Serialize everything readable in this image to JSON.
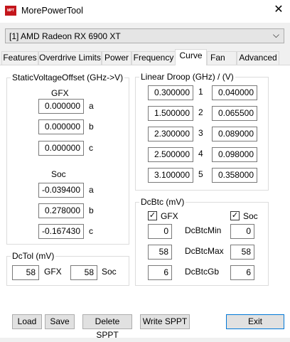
{
  "window": {
    "title": "MorePowerTool",
    "icon_text": "MPT",
    "close_glyph": "✕"
  },
  "gpu_select": {
    "value": "[1] AMD Radeon RX 6900 XT",
    "chevron": "⌵"
  },
  "tabs": [
    {
      "label": "Features"
    },
    {
      "label": "Overdrive Limits"
    },
    {
      "label": "Power"
    },
    {
      "label": "Frequency"
    },
    {
      "label": "Curve",
      "active": true
    },
    {
      "label": "Fan"
    },
    {
      "label": "Advanced"
    }
  ],
  "static_voltage": {
    "title": "StaticVoltageOffset (GHz->V)",
    "gfx_label": "GFX",
    "gfx": [
      {
        "value": "0.000000",
        "label": "a"
      },
      {
        "value": "0.000000",
        "label": "b"
      },
      {
        "value": "0.000000",
        "label": "c"
      }
    ],
    "soc_label": "Soc",
    "soc": [
      {
        "value": "-0.039400",
        "label": "a"
      },
      {
        "value": "0.278000",
        "label": "b"
      },
      {
        "value": "-0.167430",
        "label": "c"
      }
    ]
  },
  "linear_droop": {
    "title": "Linear Droop (GHz) / (V)",
    "rows": [
      {
        "ghz": "0.300000",
        "index": "1",
        "v": "0.040000"
      },
      {
        "ghz": "1.500000",
        "index": "2",
        "v": "0.065500"
      },
      {
        "ghz": "2.300000",
        "index": "3",
        "v": "0.089000"
      },
      {
        "ghz": "2.500000",
        "index": "4",
        "v": "0.098000"
      },
      {
        "ghz": "3.100000",
        "index": "5",
        "v": "0.358000"
      }
    ]
  },
  "dctol": {
    "title": "DcTol (mV)",
    "gfx_value": "58",
    "gfx_label": "GFX",
    "soc_value": "58",
    "soc_label": "Soc"
  },
  "dcbtc": {
    "title": "DcBtc (mV)",
    "gfx_check_label": "GFX",
    "gfx_checked": true,
    "soc_check_label": "Soc",
    "soc_checked": true,
    "check_glyph": "✓",
    "rows": [
      {
        "gfx": "0",
        "label": "DcBtcMin",
        "soc": "0"
      },
      {
        "gfx": "58",
        "label": "DcBtcMax",
        "soc": "58"
      },
      {
        "gfx": "6",
        "label": "DcBtcGb",
        "soc": "6"
      }
    ]
  },
  "buttons": {
    "load": "Load",
    "save": "Save",
    "delete_sppt": "Delete SPPT",
    "write_sppt": "Write SPPT",
    "exit": "Exit"
  }
}
